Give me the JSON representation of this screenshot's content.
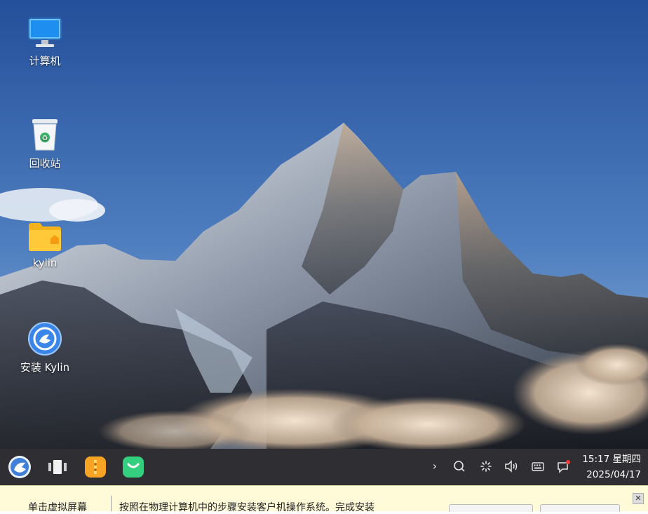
{
  "desktop": {
    "icons": [
      {
        "label": "计算机",
        "icon": "computer-icon"
      },
      {
        "label": "回收站",
        "icon": "trash-icon"
      },
      {
        "label": "kylin",
        "icon": "home-folder-icon"
      },
      {
        "label": "安装 Kylin",
        "icon": "kylin-installer-icon"
      }
    ]
  },
  "taskbar": {
    "start_icon": "kylin-start-icon",
    "pinned": [
      "multitask-view-icon",
      "file-manager-icon",
      "software-store-icon"
    ],
    "tray": [
      "chevron-right-icon",
      "search-icon",
      "network-loading-icon",
      "volume-icon",
      "keyboard-icon",
      "notification-icon"
    ],
    "time": "15:17 星期四",
    "date": "2025/04/17"
  },
  "notice": {
    "left_text": "单击虚拟屏幕",
    "right_text": "按照在物理计算机中的步骤安装客户机操作系统。完成安装"
  },
  "colors": {
    "taskbar": "#2f2f33",
    "notice_bg": "#fffbd9",
    "sky_top": "#2a5ca8",
    "sky_bottom": "#7aa4d2"
  }
}
